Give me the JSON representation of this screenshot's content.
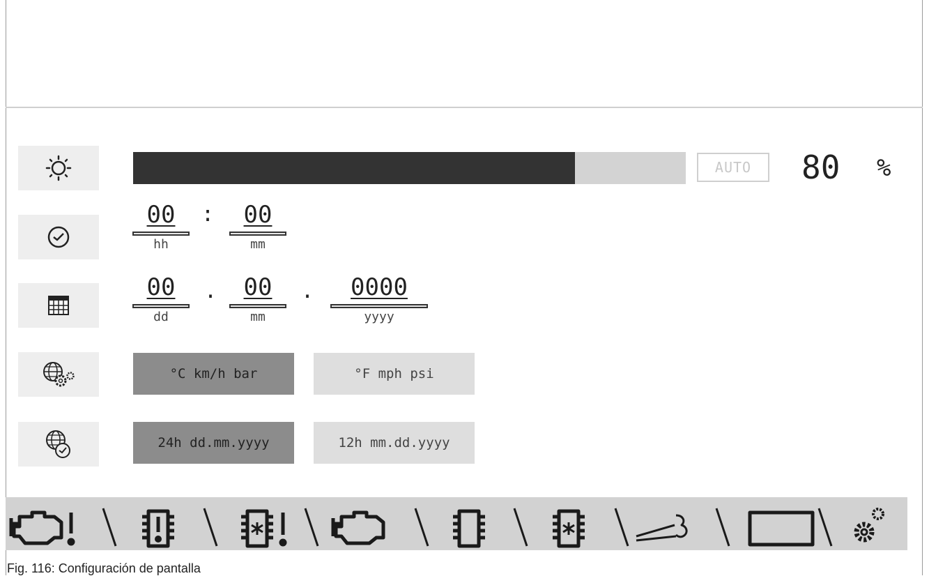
{
  "brightness": {
    "icon": "sun-icon",
    "level_percent": 80,
    "auto_label": "AUTO",
    "value": "80",
    "unit": "%"
  },
  "time": {
    "icon": "clock-icon",
    "hours": "00",
    "minutes": "00",
    "separator": ":",
    "hours_label": "hh",
    "minutes_label": "mm"
  },
  "date": {
    "icon": "calendar-icon",
    "day": "00",
    "month": "00",
    "year": "0000",
    "separator": ".",
    "day_label": "dd",
    "month_label": "mm",
    "year_label": "yyyy"
  },
  "units": {
    "icon": "globe-gears-icon",
    "metric_label": "°C km/h bar",
    "imperial_label": "°F mph psi",
    "selected": "metric"
  },
  "datetime_format": {
    "icon": "globe-clock-icon",
    "format_24h_label": "24h dd.mm.yyyy",
    "format_12h_label": "12h mm.dd.yyyy",
    "selected": "24h"
  },
  "status_bar": {
    "icons": [
      "engine-warning-icon",
      "chip-warning-icon",
      "chip-star-warning-icon",
      "engine-icon",
      "chip-icon",
      "chip-star-icon",
      "exhaust-icon",
      "rectangle-icon",
      "gears-icon"
    ]
  },
  "colors": {
    "selected_bg": "#8c8c8c",
    "unselected_bg": "#dedede",
    "bar_fill": "#333333",
    "bar_track": "#d3d3d3",
    "status_bg": "#d2d2d2"
  },
  "caption": "Fig. 116: Configuración de pantalla"
}
